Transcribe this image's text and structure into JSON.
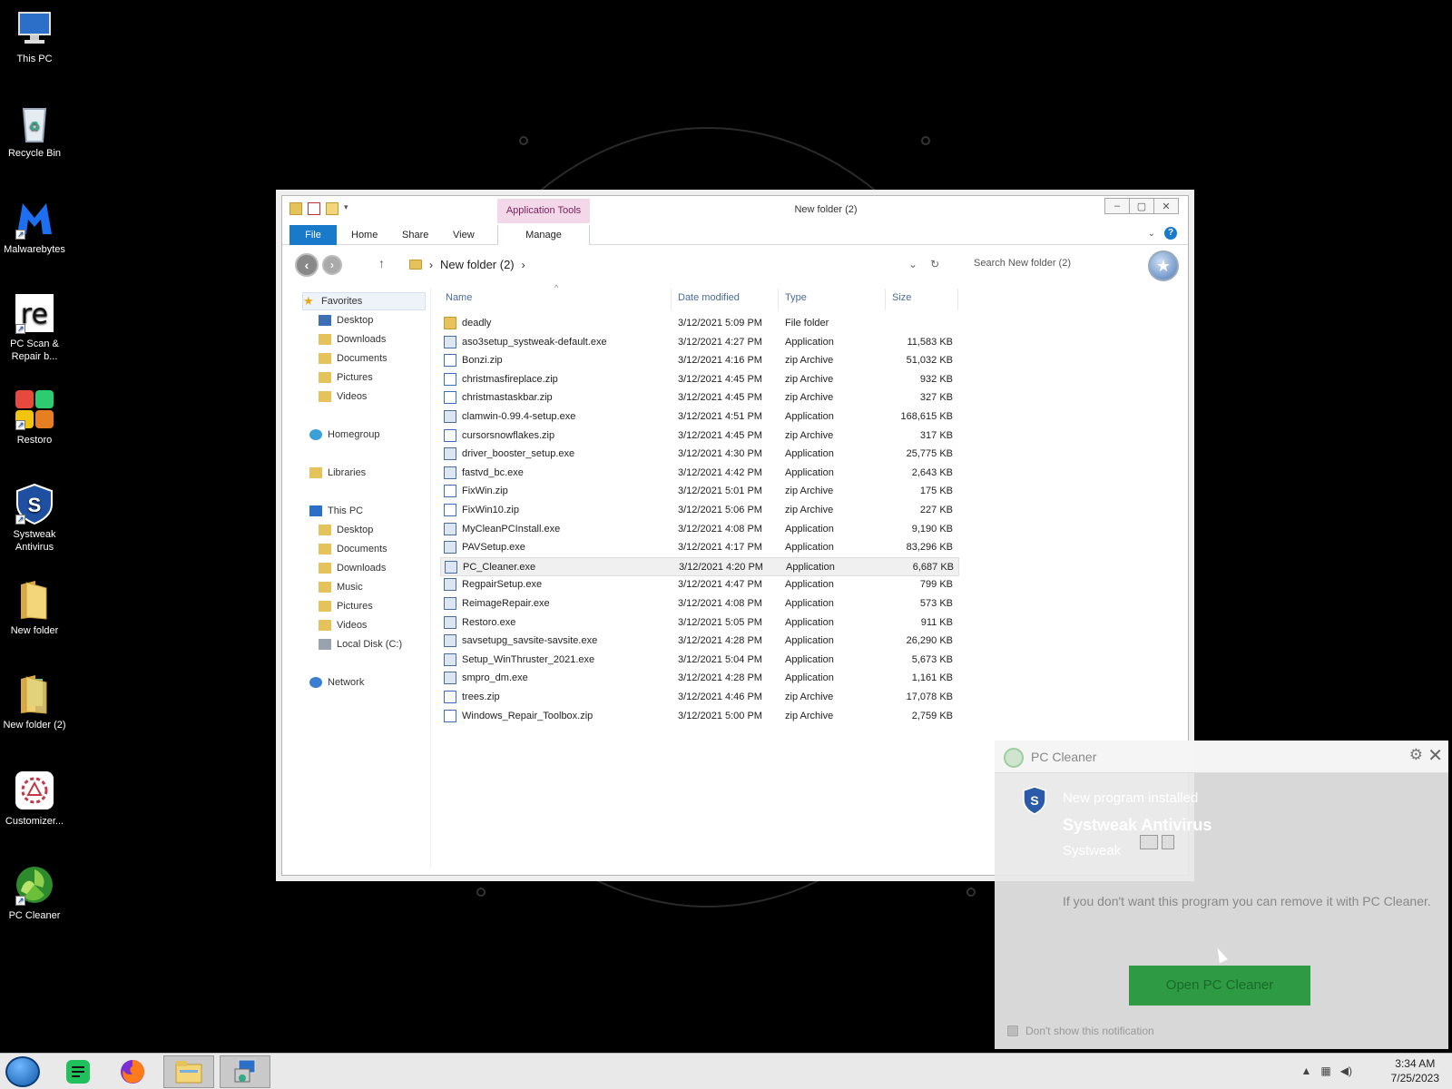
{
  "desktop": {
    "icons": [
      {
        "label": "This PC"
      },
      {
        "label": "Recycle Bin"
      },
      {
        "label": "Malwarebytes"
      },
      {
        "label": "PC Scan & Repair b..."
      },
      {
        "label": "Restoro"
      },
      {
        "label": "Systweak Antivirus"
      },
      {
        "label": "New folder"
      },
      {
        "label": "New folder (2)"
      },
      {
        "label": "Customizer..."
      },
      {
        "label": "PC Cleaner"
      }
    ]
  },
  "explorer": {
    "title": "New folder (2)",
    "context_tab": "Application Tools",
    "tabs": {
      "file": "File",
      "home": "Home",
      "share": "Share",
      "view": "View",
      "manage": "Manage"
    },
    "breadcrumb": "New folder (2)",
    "search_placeholder": "Search New folder (2)",
    "nav": {
      "favorites": "Favorites",
      "fav_desktop": "Desktop",
      "fav_downloads": "Downloads",
      "fav_documents": "Documents",
      "fav_pictures": "Pictures",
      "fav_videos": "Videos",
      "homegroup": "Homegroup",
      "libraries": "Libraries",
      "this_pc": "This PC",
      "pc_desktop": "Desktop",
      "pc_documents": "Documents",
      "pc_downloads": "Downloads",
      "pc_music": "Music",
      "pc_pictures": "Pictures",
      "pc_videos": "Videos",
      "local_disk": "Local Disk (C:)",
      "network": "Network"
    },
    "columns": {
      "name": "Name",
      "date": "Date modified",
      "type": "Type",
      "size": "Size"
    },
    "files": [
      {
        "name": "deadly",
        "date": "3/12/2021 5:09 PM",
        "type": "File folder",
        "size": ""
      },
      {
        "name": "aso3setup_systweak-default.exe",
        "date": "3/12/2021 4:27 PM",
        "type": "Application",
        "size": "11,583 KB"
      },
      {
        "name": "Bonzi.zip",
        "date": "3/12/2021 4:16 PM",
        "type": "zip Archive",
        "size": "51,032 KB"
      },
      {
        "name": "christmasfireplace.zip",
        "date": "3/12/2021 4:45 PM",
        "type": "zip Archive",
        "size": "932 KB"
      },
      {
        "name": "christmastaskbar.zip",
        "date": "3/12/2021 4:45 PM",
        "type": "zip Archive",
        "size": "327 KB"
      },
      {
        "name": "clamwin-0.99.4-setup.exe",
        "date": "3/12/2021 4:51 PM",
        "type": "Application",
        "size": "168,615 KB"
      },
      {
        "name": "cursorsnowflakes.zip",
        "date": "3/12/2021 4:45 PM",
        "type": "zip Archive",
        "size": "317 KB"
      },
      {
        "name": "driver_booster_setup.exe",
        "date": "3/12/2021 4:30 PM",
        "type": "Application",
        "size": "25,775 KB"
      },
      {
        "name": "fastvd_bc.exe",
        "date": "3/12/2021 4:42 PM",
        "type": "Application",
        "size": "2,643 KB"
      },
      {
        "name": "FixWin.zip",
        "date": "3/12/2021 5:01 PM",
        "type": "zip Archive",
        "size": "175 KB"
      },
      {
        "name": "FixWin10.zip",
        "date": "3/12/2021 5:06 PM",
        "type": "zip Archive",
        "size": "227 KB"
      },
      {
        "name": "MyCleanPCInstall.exe",
        "date": "3/12/2021 4:08 PM",
        "type": "Application",
        "size": "9,190 KB"
      },
      {
        "name": "PAVSetup.exe",
        "date": "3/12/2021 4:17 PM",
        "type": "Application",
        "size": "83,296 KB"
      },
      {
        "name": "PC_Cleaner.exe",
        "date": "3/12/2021 4:20 PM",
        "type": "Application",
        "size": "6,687 KB"
      },
      {
        "name": "RegpairSetup.exe",
        "date": "3/12/2021 4:47 PM",
        "type": "Application",
        "size": "799 KB"
      },
      {
        "name": "ReimageRepair.exe",
        "date": "3/12/2021 4:08 PM",
        "type": "Application",
        "size": "573 KB"
      },
      {
        "name": "Restoro.exe",
        "date": "3/12/2021 5:05 PM",
        "type": "Application",
        "size": "911 KB"
      },
      {
        "name": "savsetupg_savsite-savsite.exe",
        "date": "3/12/2021 4:28 PM",
        "type": "Application",
        "size": "26,290 KB"
      },
      {
        "name": "Setup_WinThruster_2021.exe",
        "date": "3/12/2021 5:04 PM",
        "type": "Application",
        "size": "5,673 KB"
      },
      {
        "name": "smpro_dm.exe",
        "date": "3/12/2021 4:28 PM",
        "type": "Application",
        "size": "1,161 KB"
      },
      {
        "name": "trees.zip",
        "date": "3/12/2021 4:46 PM",
        "type": "zip Archive",
        "size": "17,078 KB"
      },
      {
        "name": "Windows_Repair_Toolbox.zip",
        "date": "3/12/2021 5:00 PM",
        "type": "zip Archive",
        "size": "2,759 KB"
      }
    ]
  },
  "notification": {
    "app": "PC Cleaner",
    "subtitle": "New program installed",
    "program": "Systweak Antivirus",
    "publisher": "Systweak",
    "message": "If you don't want this program you can remove it with PC Cleaner.",
    "button": "Open PC Cleaner",
    "checkbox": "Don't show this notification"
  },
  "taskbar": {
    "time": "3:34 AM",
    "date": "7/25/2023"
  },
  "colors": {
    "accent": "#1979ca",
    "context_tab": "#f3d8ea",
    "toast_button": "#2e9a43"
  }
}
